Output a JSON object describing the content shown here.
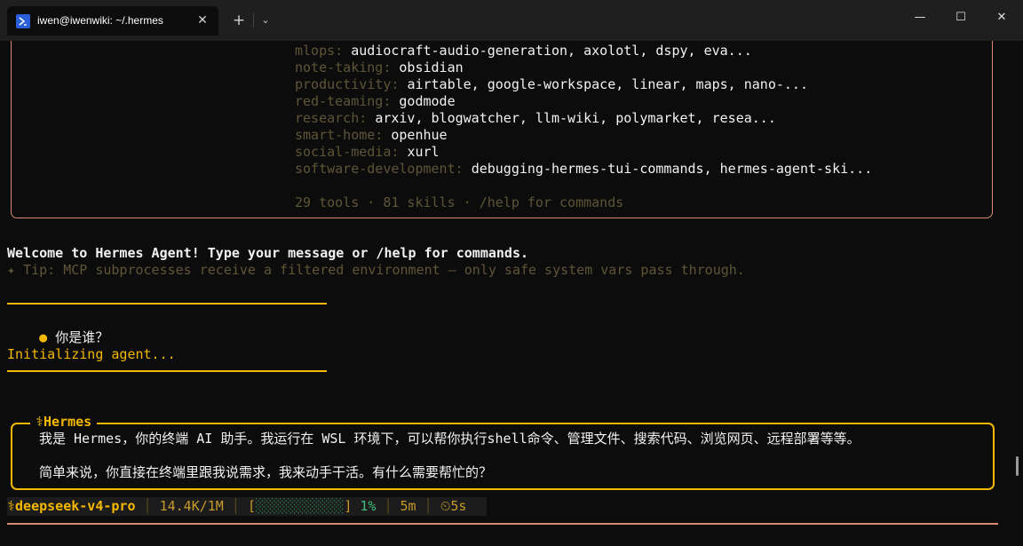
{
  "window": {
    "tab_title": "iwen@iwenwiki: ~/.hermes",
    "tab_icon": "powershell-icon",
    "new_tab": "+",
    "dropdown": "⌄",
    "minimize": "—",
    "maximize": "☐",
    "close": "✕"
  },
  "skills": [
    {
      "category": "mlops:",
      "items": "audiocraft-audio-generation, axolotl, dspy, eva..."
    },
    {
      "category": "note-taking:",
      "items": "obsidian"
    },
    {
      "category": "productivity:",
      "items": "airtable, google-workspace, linear, maps, nano-..."
    },
    {
      "category": "red-teaming:",
      "items": "godmode"
    },
    {
      "category": "research:",
      "items": "arxiv, blogwatcher, llm-wiki, polymarket, resea..."
    },
    {
      "category": "smart-home:",
      "items": "openhue"
    },
    {
      "category": "social-media:",
      "items": "xurl"
    },
    {
      "category": "software-development:",
      "items": "debugging-hermes-tui-commands, hermes-agent-ski..."
    }
  ],
  "summary": "29 tools · 81 skills · /help for commands",
  "welcome": "Welcome to Hermes Agent! Type your message or /help for commands.",
  "tip": "✦ Tip: MCP subprocesses receive a filtered environment — only safe system vars pass through.",
  "user_message": {
    "bullet": "●",
    "text": "你是谁？"
  },
  "initializing": "Initializing agent...",
  "response": {
    "label": "⚕Hermes",
    "line1": "我是 Hermes，你的终端 AI 助手。我运行在 WSL 环境下，可以帮你执行shell命令、管理文件、搜索代码、浏览网页、远程部署等等。",
    "line2": "简单来说，你直接在终端里跟我说需求，我来动手干活。有什么需要帮忙的？"
  },
  "status": {
    "model": "⚕deepseek-v4-pro",
    "tokens": "14.4K/1M",
    "bar_open": "[",
    "bar_fill": "░░░░░░░░░░░",
    "bar_close": "]",
    "percent": "1%",
    "time": "5m",
    "timer": "⏲5s",
    "sep": "│"
  },
  "colors": {
    "accent": "#f5b800",
    "border": "#d98b72",
    "background": "#0c0c0c"
  }
}
